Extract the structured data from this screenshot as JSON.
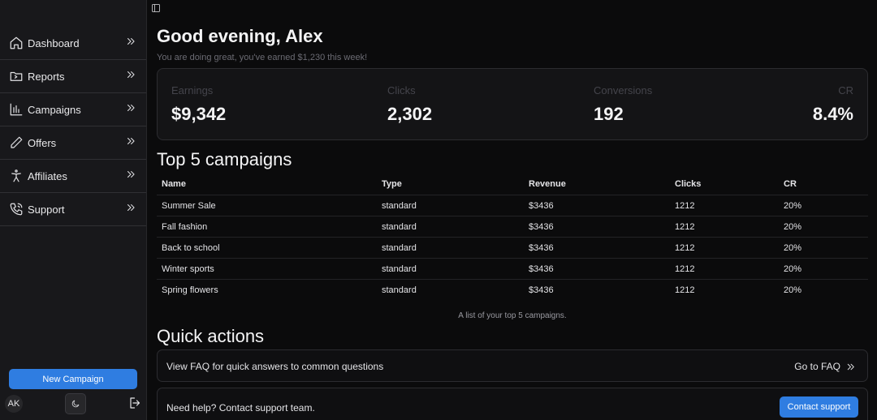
{
  "sidebar": {
    "items": [
      {
        "label": "Dashboard",
        "icon": "home-icon"
      },
      {
        "label": "Reports",
        "icon": "folder-icon"
      },
      {
        "label": "Campaigns",
        "icon": "bar-chart-icon"
      },
      {
        "label": "Offers",
        "icon": "pencil-icon"
      },
      {
        "label": "Affiliates",
        "icon": "person-icon"
      },
      {
        "label": "Support",
        "icon": "phone-icon"
      }
    ],
    "new_campaign_label": "New Campaign",
    "avatar_initials": "AK"
  },
  "header": {
    "greeting": "Good evening, Alex",
    "subtitle": "You are doing great, you've earned $1,230 this week!"
  },
  "stats": [
    {
      "label": "Earnings",
      "value": "$9,342"
    },
    {
      "label": "Clicks",
      "value": "2,302"
    },
    {
      "label": "Conversions",
      "value": "192"
    },
    {
      "label": "CR",
      "value": "8.4%"
    }
  ],
  "campaigns": {
    "title": "Top 5 campaigns",
    "columns": [
      "Name",
      "Type",
      "Revenue",
      "Clicks",
      "CR"
    ],
    "rows": [
      [
        "Summer Sale",
        "standard",
        "$3436",
        "1212",
        "20%"
      ],
      [
        "Fall fashion",
        "standard",
        "$3436",
        "1212",
        "20%"
      ],
      [
        "Back to school",
        "standard",
        "$3436",
        "1212",
        "20%"
      ],
      [
        "Winter sports",
        "standard",
        "$3436",
        "1212",
        "20%"
      ],
      [
        "Spring flowers",
        "standard",
        "$3436",
        "1212",
        "20%"
      ]
    ],
    "caption": "A list of your top 5 campaigns."
  },
  "quick_actions": {
    "title": "Quick actions",
    "faq_text": "View FAQ for quick answers to common questions",
    "faq_link": "Go to FAQ",
    "support_text": "Need help? Contact support team.",
    "support_button": "Contact support"
  },
  "colors": {
    "accent": "#2f7de1",
    "background": "#0b0b0c",
    "sidebar": "#18181b"
  }
}
